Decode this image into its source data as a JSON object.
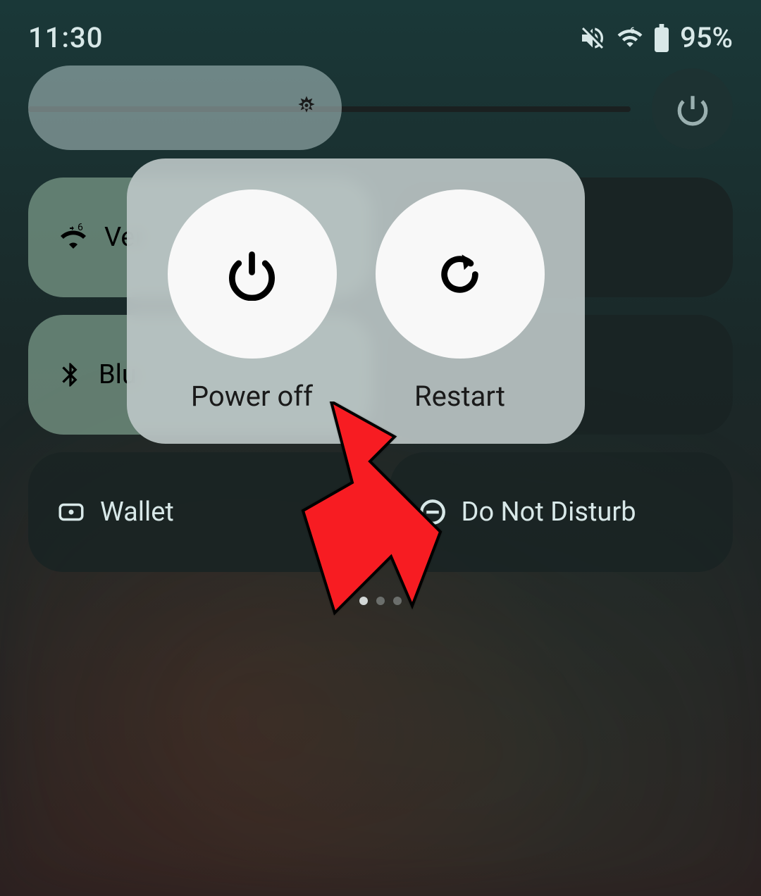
{
  "statusBar": {
    "time": "11:30",
    "battery": "95%"
  },
  "quickSettings": {
    "tiles": [
      {
        "label": "Ver",
        "active": true
      },
      {
        "label": "",
        "active": false
      },
      {
        "label": "Bluetooth",
        "labelShort": "Blu",
        "active": true
      },
      {
        "label": "",
        "active": false
      }
    ],
    "bottom": [
      {
        "label": "Wallet"
      },
      {
        "label": "Do Not Disturb"
      }
    ]
  },
  "powerDialog": {
    "options": [
      {
        "label": "Power off"
      },
      {
        "label": "Restart"
      }
    ]
  }
}
